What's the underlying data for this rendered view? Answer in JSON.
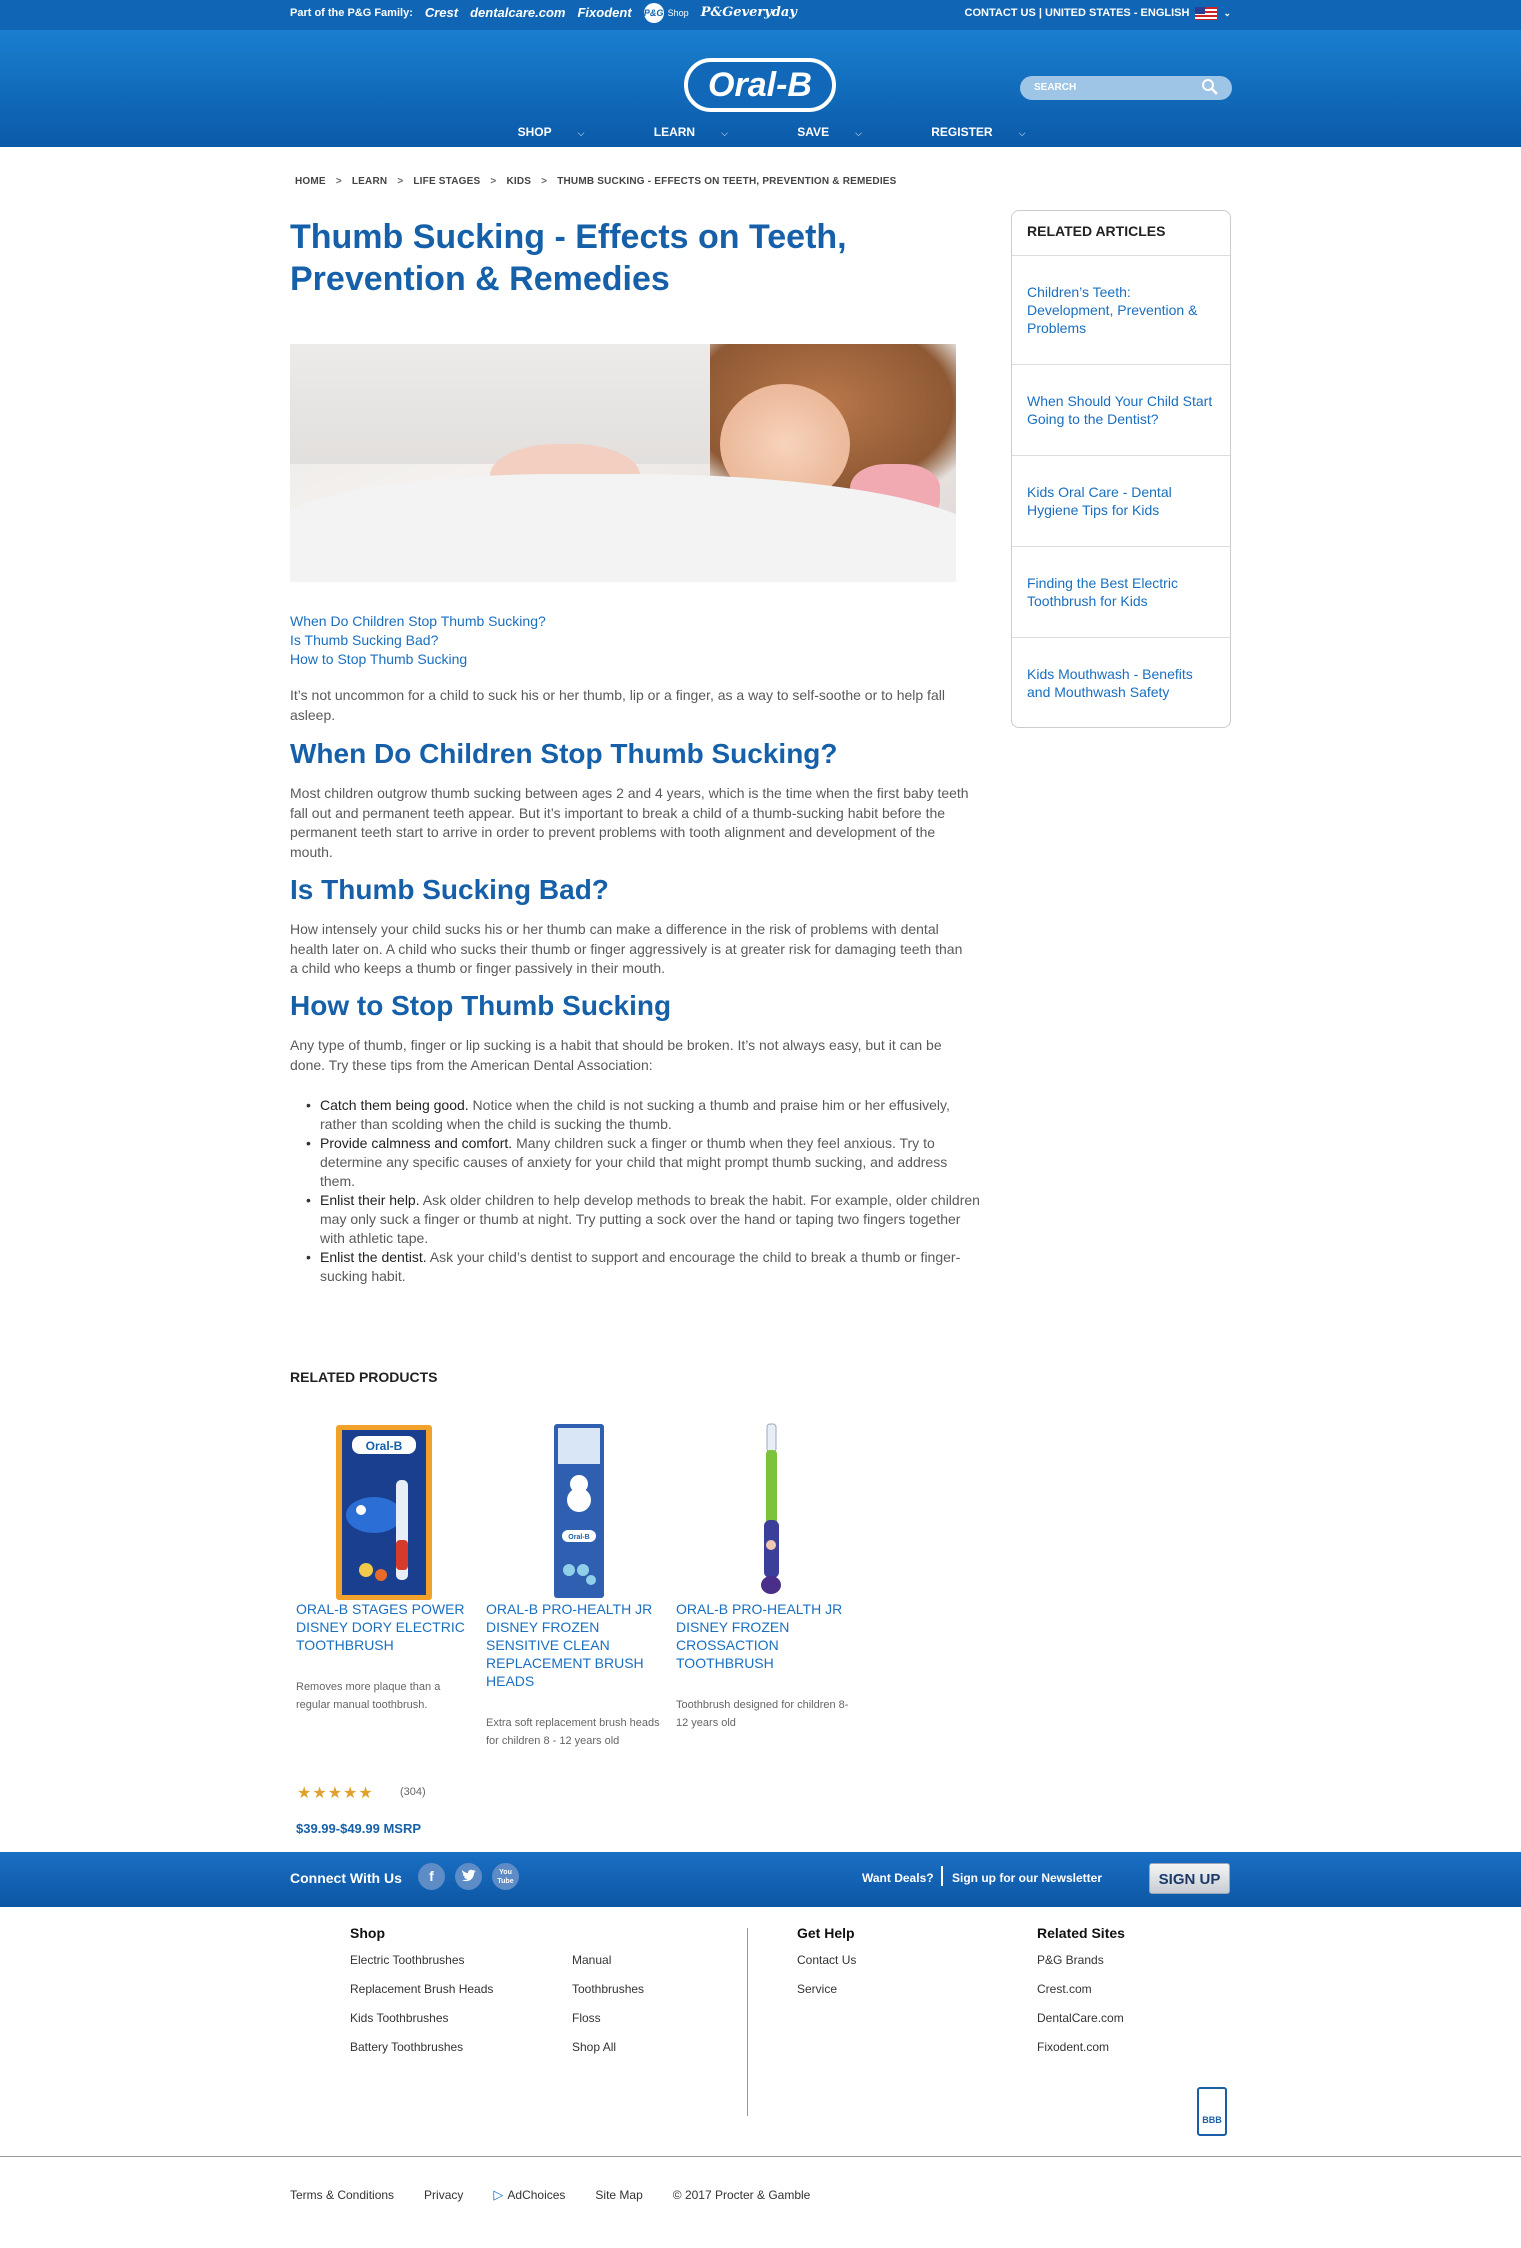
{
  "topbar": {
    "family_label": "Part of the P&G Family:",
    "brands": [
      "Crest",
      "dentalcare.com",
      "Fixodent",
      "P&G",
      "Shop",
      "P&Geveryday"
    ],
    "right_text": "CONTACT US | UNITED STATES - ENGLISH"
  },
  "header": {
    "logo": "Oral-B",
    "nav": [
      "SHOP",
      "LEARN",
      "SAVE",
      "REGISTER"
    ],
    "search_placeholder": "SEARCH"
  },
  "breadcrumb": [
    "HOME",
    "LEARN",
    "LIFE STAGES",
    "KIDS",
    "THUMB SUCKING - EFFECTS ON TEETH, PREVENTION & REMEDIES"
  ],
  "article": {
    "title": "Thumb Sucking - Effects on Teeth, Prevention & Remedies",
    "toc": [
      "When Do Children Stop Thumb Sucking?",
      "Is Thumb Sucking Bad?",
      "How to Stop Thumb Sucking"
    ],
    "intro": "It’s not uncommon for a child to suck his or her thumb, lip or a finger, as a way to self-soothe or to help fall asleep.",
    "sections": [
      {
        "heading": "When Do Children Stop Thumb Sucking?",
        "text": "Most children outgrow thumb sucking between ages 2 and 4 years, which is the time when the first baby teeth fall out and permanent teeth appear. But it’s important to break a child of a thumb-sucking habit before the permanent teeth start to arrive in order to prevent problems with tooth alignment and development of the mouth."
      },
      {
        "heading": "Is Thumb Sucking Bad?",
        "text": "How intensely your child sucks his or her thumb can make a difference in the risk of problems with dental health later on. A child who sucks their thumb or finger aggressively is at greater risk for damaging teeth than a child who keeps a thumb or finger passively in their mouth."
      },
      {
        "heading": "How to Stop Thumb Sucking",
        "text": "Any type of thumb, finger or lip sucking is a habit that should be broken. It’s not always easy, but it can be done. Try these tips from the American Dental Association:"
      }
    ],
    "tips": [
      {
        "lead": "Catch them being good.",
        "text": " Notice when the child is not sucking a thumb and praise him or her effusively, rather than scolding when the child is sucking the thumb."
      },
      {
        "lead": "Provide calmness and comfort.",
        "text": " Many children suck a finger or thumb when they feel anxious. Try to determine any specific causes of anxiety for your child that might prompt thumb sucking, and address them."
      },
      {
        "lead": "Enlist their help.",
        "text": " Ask older children to help develop methods to break the habit. For example, older children may only suck a finger or thumb at night. Try putting a sock over the hand or taping two fingers together with athletic tape."
      },
      {
        "lead": "Enlist the dentist.",
        "text": " Ask your child’s dentist to support and encourage the child to break a thumb or finger-sucking habit."
      }
    ]
  },
  "sidebar": {
    "heading": "RELATED ARTICLES",
    "items": [
      "Children’s Teeth: Development, Prevention & Problems",
      "When Should Your Child Start Going to the Dentist?",
      "Kids Oral Care - Dental Hygiene Tips for Kids",
      "Finding the Best Electric Toothbrush for Kids",
      "Kids Mouthwash - Benefits and Mouthwash Safety"
    ]
  },
  "related_products": {
    "heading": "RELATED PRODUCTS",
    "items": [
      {
        "name": "ORAL-B STAGES POWER DISNEY DORY ELECTRIC TOOTHBRUSH",
        "desc": "Removes more plaque than a regular manual toothbrush.",
        "rating": "(304)",
        "stars": 5,
        "price": "$39.99-$49.99 MSRP"
      },
      {
        "name": "ORAL-B PRO-HEALTH JR DISNEY FROZEN SENSITIVE CLEAN REPLACEMENT BRUSH HEADS",
        "desc": "Extra soft replacement brush heads for children 8 - 12 years old"
      },
      {
        "name": "ORAL-B PRO-HEALTH JR DISNEY FROZEN CROSSACTION TOOTHBRUSH",
        "desc": "Toothbrush designed for children 8-12 years old"
      }
    ]
  },
  "footer": {
    "connect": "Connect With Us",
    "social": [
      "f",
      "t",
      "You Tube"
    ],
    "want_deals": "Want Deals?",
    "newsletter": "Sign up for our Newsletter",
    "signup": "SIGN UP",
    "shop_heading": "Shop",
    "shop_col1": [
      "Electric Toothbrushes",
      "Replacement Brush Heads",
      "Kids Toothbrushes",
      "Battery Toothbrushes"
    ],
    "shop_col2": [
      "Manual",
      "Toothbrushes",
      "Floss",
      "Shop All"
    ],
    "help_heading": "Get Help",
    "help": [
      "Contact Us",
      "Service"
    ],
    "related_heading": "Related Sites",
    "related": [
      "P&G Brands",
      "Crest.com",
      "DentalCare.com",
      "Fixodent.com"
    ],
    "bbb": "BBB",
    "legal": [
      "Terms & Conditions",
      "Privacy",
      "AdChoices",
      "Site Map",
      "© 2017 Procter & Gamble"
    ]
  },
  "colors": {
    "brand_blue": "#1066b4",
    "link_blue": "#1a6fc0",
    "heading_blue": "#1560a8",
    "star": "#e0a22c"
  }
}
